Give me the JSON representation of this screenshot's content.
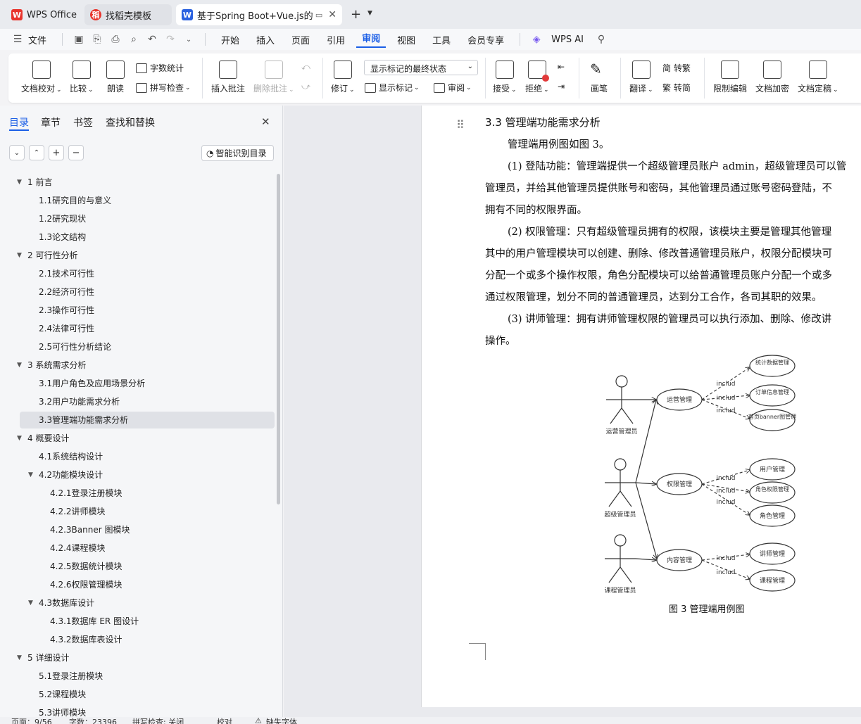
{
  "tabs": [
    {
      "label": "WPS Office",
      "logo": "W"
    },
    {
      "label": "找稻壳模板",
      "logo": "稻"
    },
    {
      "label": "基于Spring Boot+Vue.js的在",
      "logo": "W"
    }
  ],
  "menu": {
    "file": "文件",
    "items": [
      "开始",
      "插入",
      "页面",
      "引用",
      "审阅",
      "视图",
      "工具",
      "会员专享"
    ],
    "ai": "WPS AI"
  },
  "ribbon": {
    "doc_check": "文档校对",
    "compare": "比较",
    "read": "朗读",
    "word_count": "字数统计",
    "spell": "拼写检查",
    "insert_comment": "插入批注",
    "delete_comment": "删除批注",
    "revise": "修订",
    "markup_state": "显示标记的最终状态",
    "show_markup": "显示标记",
    "review": "审阅",
    "accept": "接受",
    "reject": "拒绝",
    "pen": "画笔",
    "translate": "翻译",
    "to_trad": "简 转繁",
    "to_simp": "繁 转简",
    "restrict": "限制编辑",
    "encrypt": "文档加密",
    "finalize": "文档定稿"
  },
  "panel": {
    "tabs": [
      "目录",
      "章节",
      "书签",
      "查找和替换"
    ],
    "smart_toc": "智能识别目录",
    "toc": [
      {
        "text": "1   前言",
        "arrow": true
      },
      {
        "text": "1.1研究目的与意义"
      },
      {
        "text": "1.2研究现状"
      },
      {
        "text": "1.3论文结构"
      },
      {
        "text": "2   可行性分析",
        "arrow": true
      },
      {
        "text": "2.1技术可行性"
      },
      {
        "text": "2.2经济可行性"
      },
      {
        "text": "2.3操作可行性"
      },
      {
        "text": "2.4法律可行性"
      },
      {
        "text": "2.5可行性分析结论"
      },
      {
        "text": "3   系统需求分析",
        "arrow": true
      },
      {
        "text": "3.1用户角色及应用场景分析"
      },
      {
        "text": "3.2用户功能需求分析"
      },
      {
        "text": "3.3管理端功能需求分析"
      },
      {
        "text": "4   概要设计",
        "arrow": true
      },
      {
        "text": "4.1系统结构设计"
      },
      {
        "text": "4.2功能模块设计",
        "arrow": true
      },
      {
        "text": "4.2.1登录注册模块"
      },
      {
        "text": "4.2.2讲师模块"
      },
      {
        "text": "4.2.3Banner 图模块"
      },
      {
        "text": "4.2.4课程模块"
      },
      {
        "text": "4.2.5数据统计模块"
      },
      {
        "text": "4.2.6权限管理模块"
      },
      {
        "text": "4.3数据库设计",
        "arrow": true
      },
      {
        "text": "4.3.1数据库 ER 图设计"
      },
      {
        "text": "4.3.2数据库表设计"
      },
      {
        "text": "5   详细设计",
        "arrow": true
      },
      {
        "text": "5.1登录注册模块"
      },
      {
        "text": "5.2课程模块"
      },
      {
        "text": "5.3讲师模块"
      }
    ]
  },
  "doc": {
    "heading": "3.3  管理端功能需求分析",
    "lines": [
      "管理端用例图如图 3。",
      "(1) 登陆功能：管理端提供一个超级管理员账户 admin，超级管理员可以管",
      "管理员，并给其他管理员提供账号和密码，其他管理员通过账号密码登陆，不",
      "拥有不同的权限界面。",
      "(2) 权限管理：只有超级管理员拥有的权限，该模块主要是管理其他管理",
      "其中的用户管理模块可以创建、删除、修改普通管理员账户，权限分配模块可",
      "分配一个或多个操作权限，角色分配模块可以给普通管理员账户分配一个或多",
      "通过权限管理，划分不同的普通管理员，达到分工合作，各司其职的效果。",
      "(3) 讲师管理：拥有讲师管理权限的管理员可以执行添加、删除、修改讲",
      "操作。"
    ],
    "figure_caption": "图 3  管理端用例图",
    "diagram": {
      "actors": [
        "运营管理员",
        "超级管理员",
        "课程管理员"
      ],
      "usecases": [
        "运营管理",
        "权限管理",
        "内容管理"
      ],
      "sub": [
        "统计数据管理",
        "订单信息管理",
        "首页banner图管理",
        "用户管理",
        "角色权限管理",
        "角色管理",
        "讲师管理",
        "课程管理"
      ],
      "include_label": "includ"
    }
  },
  "status": {
    "page": "页面：9/56",
    "words": "字数：23396",
    "spell": "拼写检查: 关闭",
    "proof": "校对",
    "font_missing": "缺失字体"
  },
  "colors": {
    "accent": "#1a5ee6",
    "wps_red": "#e8342c"
  }
}
